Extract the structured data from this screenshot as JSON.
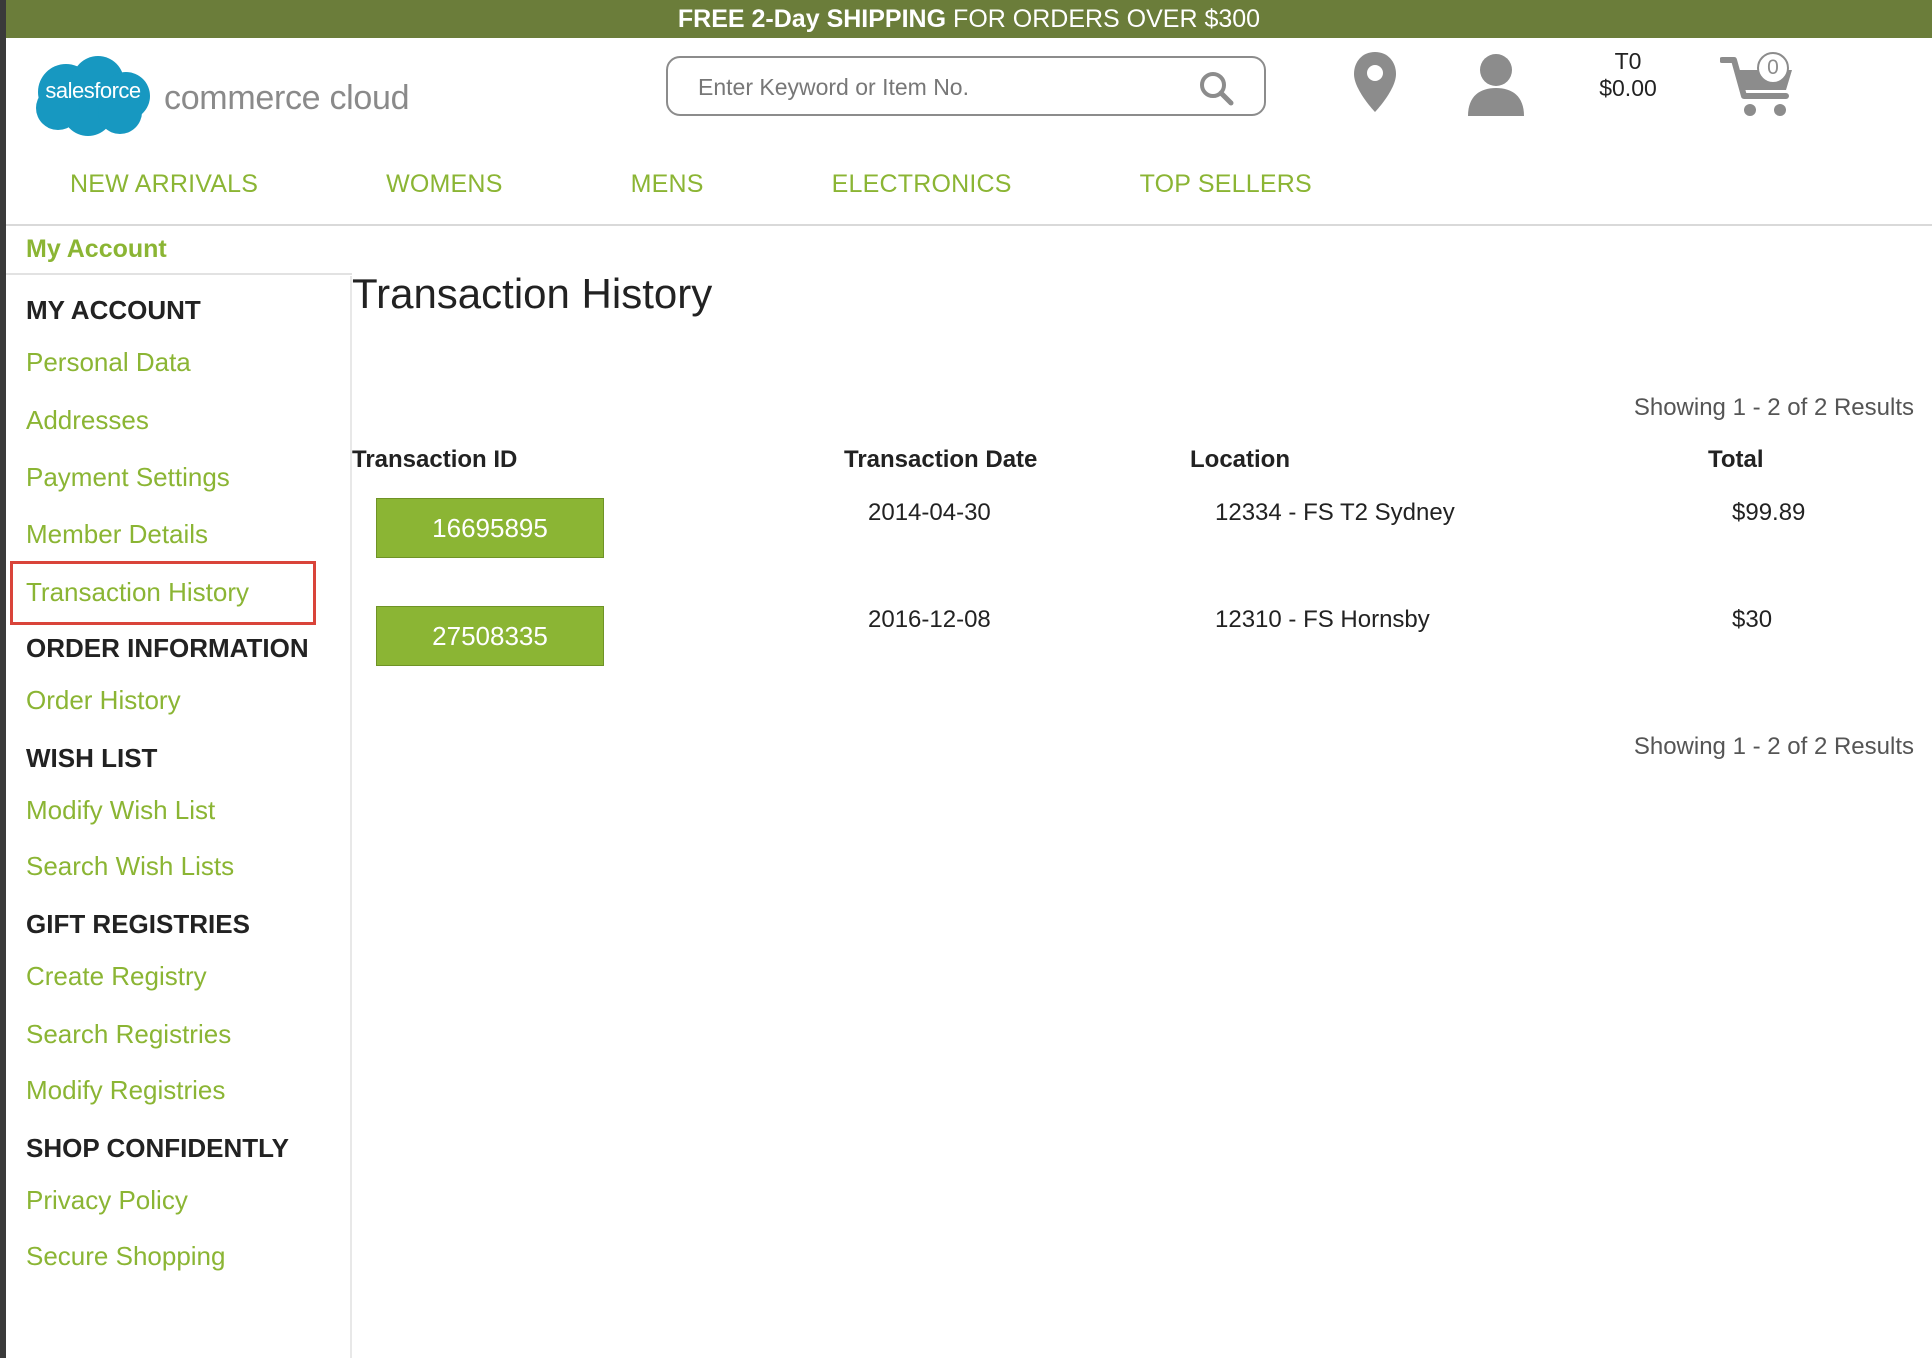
{
  "promo": {
    "bold": "FREE 2-Day SHIPPING",
    "rest": "FOR ORDERS OVER $300"
  },
  "logo": {
    "cloud_text": "salesforce",
    "text": "commerce cloud"
  },
  "search": {
    "placeholder": "Enter Keyword or Item No.",
    "icon": "search-icon"
  },
  "header": {
    "store_locator_icon": "map-pin-icon",
    "account_icon": "user-icon",
    "cart_label": "T0",
    "cart_total": "$0.00",
    "cart_icon": "cart-icon",
    "cart_count": "0"
  },
  "nav": {
    "items": [
      {
        "label": "NEW ARRIVALS"
      },
      {
        "label": "WOMENS"
      },
      {
        "label": "MENS"
      },
      {
        "label": "ELECTRONICS"
      },
      {
        "label": "TOP SELLERS"
      }
    ]
  },
  "breadcrumb": {
    "label": "My Account"
  },
  "sidebar": {
    "my_account": {
      "heading": "MY ACCOUNT",
      "items": [
        "Personal Data",
        "Addresses",
        "Payment Settings",
        "Member Details",
        "Transaction History"
      ]
    },
    "order_info": {
      "heading": "ORDER INFORMATION",
      "items": [
        "Order History"
      ]
    },
    "wish_list": {
      "heading": "WISH LIST",
      "items": [
        "Modify Wish List",
        "Search Wish Lists"
      ]
    },
    "gift_registries": {
      "heading": "GIFT REGISTRIES",
      "items": [
        "Create Registry",
        "Search Registries",
        "Modify Registries"
      ]
    },
    "shop_confidently": {
      "heading": "SHOP CONFIDENTLY",
      "items": [
        "Privacy Policy",
        "Secure Shopping"
      ]
    },
    "active_item": "Transaction History"
  },
  "main": {
    "title": "Transaction History",
    "results_text": "Showing 1 - 2 of 2 Results",
    "columns": [
      "Transaction ID",
      "Transaction Date",
      "Location",
      "Total"
    ],
    "rows": [
      {
        "id": "16695895",
        "date": "2014-04-30",
        "location": "12334 - FS T2 Sydney",
        "total": "$99.89"
      },
      {
        "id": "27508335",
        "date": "2016-12-08",
        "location": "12310 - FS Hornsby",
        "total": "$30"
      }
    ]
  },
  "colors": {
    "accent": "#8bb534",
    "promo_bg": "#6b7d3a",
    "highlight": "#d9443a"
  }
}
